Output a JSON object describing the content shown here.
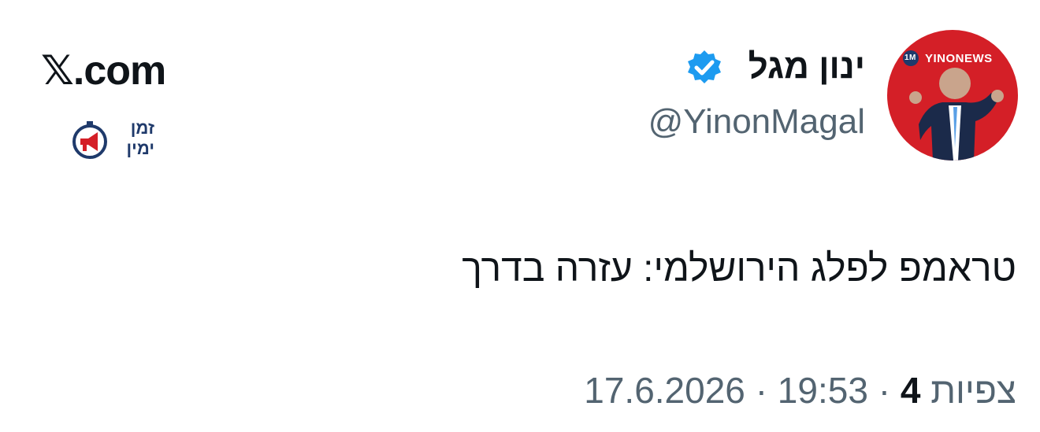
{
  "site": {
    "label": "𝕏.com"
  },
  "brand": {
    "line1": "זמן",
    "line2": "ימין"
  },
  "author": {
    "name": "ינון מגל",
    "handle": "@YinonMagal",
    "avatar_badge": "YINONEWS",
    "avatar_badge_prefix": "1M",
    "verified": true,
    "verified_icon": "verified-badge-icon"
  },
  "tweet": {
    "text": "טראמפ לפלג הירושלמי: עזרה בדרך"
  },
  "meta": {
    "date": "17.6.2026",
    "separator": "·",
    "time": "19:53",
    "views_count": "4",
    "views_label": "צפיות"
  },
  "colors": {
    "text": "#0f1419",
    "muted": "#536471",
    "verified": "#1d9bf0",
    "avatar_bg": "#d41f27",
    "brand_navy": "#1f3a6b"
  }
}
